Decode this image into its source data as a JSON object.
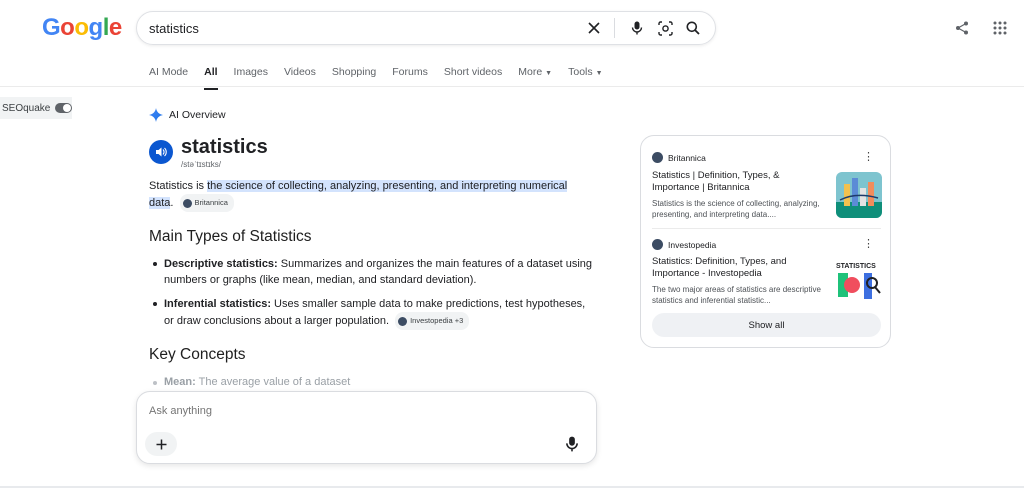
{
  "header": {
    "logo_letters": [
      "G",
      "o",
      "o",
      "g",
      "l",
      "e"
    ],
    "search_value": "statistics"
  },
  "tabs": [
    {
      "label": "AI Mode"
    },
    {
      "label": "All",
      "active": true
    },
    {
      "label": "Images"
    },
    {
      "label": "Videos"
    },
    {
      "label": "Shopping"
    },
    {
      "label": "Forums"
    },
    {
      "label": "Short videos"
    },
    {
      "label": "More",
      "caret": true
    },
    {
      "label": "Tools",
      "caret": true
    }
  ],
  "seoquake": {
    "label": "SEOquake"
  },
  "ai_overview": {
    "label": "AI Overview",
    "word": "statistics",
    "phonetic": "/stəˈtɪstɪks/",
    "definition_prefix": "Statistics is ",
    "definition_highlight_1": "the science of collecting, analyzing, presenting, and interpreting numerical",
    "definition_highlight_2": "data",
    "definition_suffix": ".",
    "definition_source": "Britannica",
    "heading_types": "Main Types of Statistics",
    "bullets": [
      {
        "term": "Descriptive statistics:",
        "text": " Summarizes and organizes the main features of a dataset using numbers or graphs (like mean, median, and standard deviation)."
      },
      {
        "term": "Inferential statistics:",
        "text": " Uses smaller sample data to make predictions, test hypotheses, or draw conclusions about a larger population.",
        "source": "Investopedia +3"
      }
    ],
    "heading_concepts": "Key Concepts",
    "faded_term": "Mean:",
    "faded_text": " The average value of a dataset"
  },
  "askbox": {
    "placeholder": "Ask anything"
  },
  "sources": [
    {
      "site": "Britannica",
      "title": "Statistics | Definition, Types, & Importance | Britannica",
      "snippet": "Statistics is the science of collecting, analyzing, presenting, and interpreting data...."
    },
    {
      "site": "Investopedia",
      "title": "Statistics: Definition, Types, and Importance - Investopedia",
      "snippet": "The two major areas of statistics are descriptive statistics and inferential statistic...",
      "thumb_text": "STATISTICS"
    }
  ],
  "show_all_label": "Show all",
  "colors": {
    "accent": "#0b57d0",
    "highlight": "#d3e3fd"
  }
}
